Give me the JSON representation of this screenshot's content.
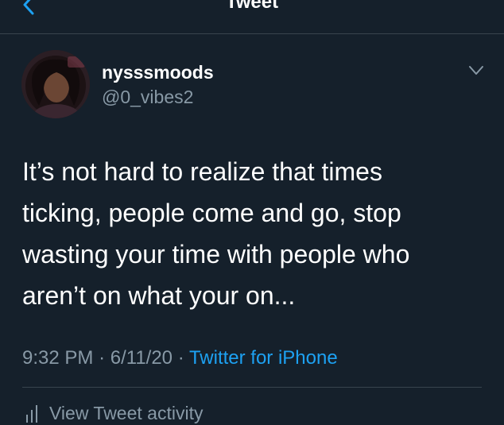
{
  "header": {
    "title": "Tweet",
    "back_icon": "chevron-left-icon"
  },
  "tweet": {
    "display_name": "nysssmoods",
    "handle": "@0_vibes2",
    "caret_icon": "chevron-down-icon",
    "text_lines": [
      "It’s not hard to realize that times",
      "ticking, people come and go, stop",
      "wasting your time with people who",
      "aren’t on what your on..."
    ],
    "time": "9:32 PM",
    "separator": "·",
    "date": "6/11/20",
    "source": "Twitter for iPhone"
  },
  "activity": {
    "icon": "bar-chart-icon",
    "label": "View Tweet activity"
  },
  "colors": {
    "background": "#15202b",
    "text": "#ffffff",
    "secondary": "#8899a6",
    "accent": "#1da1f2",
    "divider": "#38444d"
  }
}
